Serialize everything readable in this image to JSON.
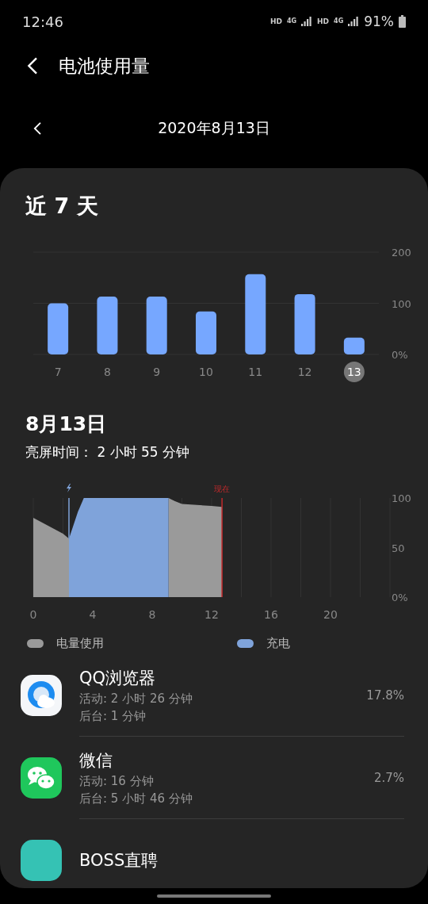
{
  "status_bar": {
    "time": "12:46",
    "network": [
      {
        "hd": "HD",
        "gen": "4G"
      },
      {
        "hd": "HD",
        "gen": "4G"
      }
    ],
    "battery": "91%"
  },
  "header": {
    "title": "电池使用量"
  },
  "date_nav": {
    "date": "2020年8月13日"
  },
  "seven_days": {
    "title": "近 7 天",
    "chart_data": {
      "type": "bar",
      "categories": [
        "7",
        "8",
        "9",
        "10",
        "11",
        "12",
        "13"
      ],
      "values": [
        100,
        113,
        113,
        84,
        157,
        118,
        33
      ],
      "ylim": [
        0,
        200
      ],
      "yticks": [
        {
          "value": 0,
          "label": "0%"
        },
        {
          "value": 100,
          "label": "100"
        },
        {
          "value": 200,
          "label": "200"
        }
      ]
    },
    "day_states": [
      {
        "selected": false
      },
      {
        "selected": false
      },
      {
        "selected": false
      },
      {
        "selected": false
      },
      {
        "selected": false
      },
      {
        "selected": false
      },
      {
        "selected": true
      }
    ]
  },
  "day_detail": {
    "title": "8月13日",
    "screen_time": "亮屏时间： 2 小时 55 分钟",
    "chart_data": {
      "type": "area",
      "x": [
        0,
        1,
        2,
        2.4,
        3,
        3.4,
        5,
        9.1,
        9.5,
        10,
        11,
        12,
        12.7
      ],
      "series": [
        {
          "name": "电量使用",
          "color": "#9a9a9a",
          "values": [
            80,
            72,
            64,
            59,
            null,
            null,
            null,
            100,
            97,
            94,
            93,
            92,
            91
          ]
        },
        {
          "name": "充电",
          "color": "#7fa3da",
          "values": [
            null,
            null,
            null,
            59,
            86,
            100,
            100,
            100,
            null,
            null,
            null,
            null,
            null
          ]
        }
      ],
      "xlim": [
        0,
        24
      ],
      "ylim": [
        0,
        100
      ],
      "grid": true,
      "xticks": [
        0,
        4,
        8,
        12,
        16,
        20
      ],
      "yticks": [
        {
          "value": 0,
          "label": "0%"
        },
        {
          "value": 50,
          "label": "50"
        },
        {
          "value": 100,
          "label": "100"
        }
      ],
      "annotations": [
        {
          "x": 12.7,
          "text": "现在"
        }
      ]
    }
  },
  "apps": [
    {
      "kind": "qq-browser",
      "name": "QQ浏览器",
      "active": "活动: 2 小时 26 分钟",
      "background": "后台: 1 分钟",
      "share": "17.8%"
    },
    {
      "kind": "wechat",
      "name": "微信",
      "active": "活动: 16 分钟",
      "background": "后台: 5 小时 46 分钟",
      "share": "2.7%"
    },
    {
      "kind": "boss",
      "name": "BOSS直聘"
    }
  ]
}
